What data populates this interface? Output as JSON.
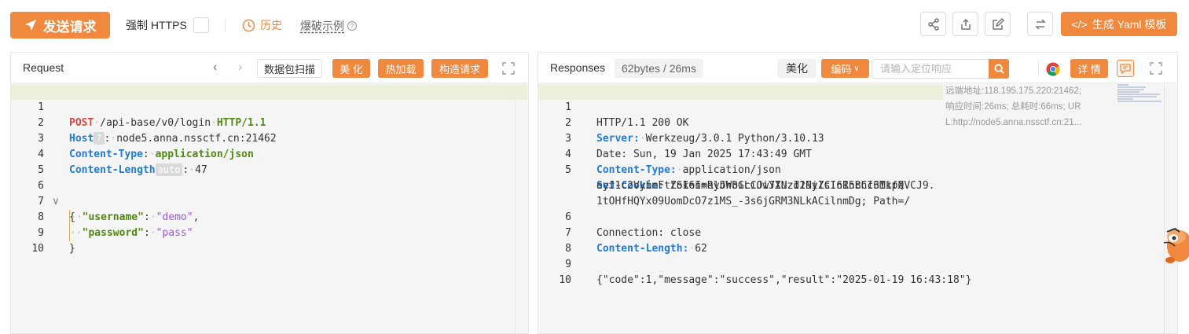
{
  "toolbar": {
    "send_label": "发送请求",
    "force_https_label": "强制 HTTPS",
    "history_label": "历史",
    "blast_label": "爆破示例",
    "yaml_label": "生成 Yaml 模板",
    "accent_color": "#f0883e"
  },
  "request": {
    "title": "Request",
    "buttons": {
      "packet_scan": "数据包扫描",
      "beautify": "美 化",
      "hot_load": "热加载",
      "build_request": "构造请求"
    },
    "lines": [
      {
        "n": "1",
        "method": "POST",
        "path": "/api-base/v0/login",
        "proto": "HTTP/1.1"
      },
      {
        "n": "2",
        "key": "Host",
        "badge": "?",
        "value": "node5.anna.nssctf.cn:21462"
      },
      {
        "n": "3",
        "key": "Content-Type",
        "value": "application/json"
      },
      {
        "n": "4",
        "key": "Content-Length",
        "badge": "auto",
        "value": "47"
      },
      {
        "n": "5"
      },
      {
        "n": "6",
        "text": "{"
      },
      {
        "n": "7",
        "jkey": "\"username\"",
        "jval": "\"demo\"",
        "trail": ","
      },
      {
        "n": "8",
        "jkey": "\"password\"",
        "jval": "\"pass\"",
        "trail": ""
      },
      {
        "n": "9",
        "text": "}"
      },
      {
        "n": "10"
      }
    ]
  },
  "response": {
    "title": "Responses",
    "size_time": "62bytes / 26ms",
    "beautify": "美化",
    "encoding": "编码",
    "search_placeholder": "请输入定位响应",
    "detail": "详 情",
    "meta": {
      "remote": "远端地址:118.195.175.220:21462;",
      "timing": "响应时间:26ms; 总耗时:66ms; UR",
      "url": "L:http://node5.anna.nssctf.cn:21..."
    },
    "lines": {
      "l1": "HTTP/1.1 200 OK",
      "l2k": "Server:",
      "l2v": "Werkzeug/3.0.1 Python/3.10.13",
      "l3": "Date: Sun, 19 Jan 2025 17:43:49 GMT",
      "l4k": "Content-Type:",
      "l4v": "application/json",
      "l5k": "Set-Cookie:",
      "l5v": "token=eyJhbGciOiJIUzI1NiIsInR5cCI6IkpXVCJ9.",
      "l5b": "eyJ1c2VybmFtZSI6ImRlbW8iLCJwYXNzd29yZCI6InBhc3MifQ.",
      "l5c": "1tOHfHQYx09UomDcO7z1MS_-3s6jGRM3NLkACilnmDg; Path=/",
      "l6": "Connection: close",
      "l7k": "Content-Length:",
      "l7v": "62",
      "l9": "{\"code\":1,\"message\":\"success\",\"result\":\"2025-01-19 16:43:18\"}"
    },
    "line_numbers": [
      "1",
      "2",
      "3",
      "4",
      "5",
      "6",
      "7",
      "8",
      "9",
      "10"
    ]
  }
}
